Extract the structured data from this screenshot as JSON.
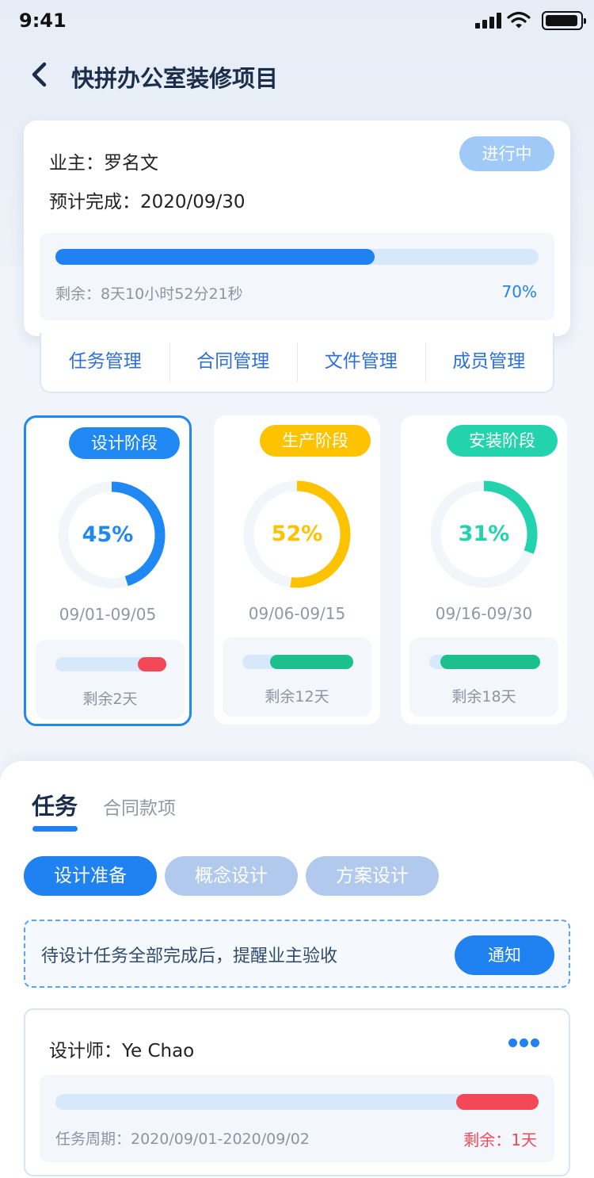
{
  "status_bar": {
    "time": "9:41"
  },
  "nav": {
    "title": "快拼办公室装修项目"
  },
  "project": {
    "owner": "业主：罗名文",
    "expected_finish": "预计完成：2020/09/30",
    "status": "进行中",
    "progress": 0.66,
    "remaining": "剩余：8天10小时52分21秒",
    "percent_label": "70%"
  },
  "management_tabs": [
    "任务管理",
    "合同管理",
    "文件管理",
    "成员管理"
  ],
  "stages": [
    {
      "name": "设计阶段",
      "percent_label": "45%",
      "progress": 0.45,
      "dates": "09/01-09/05",
      "remaining": "剩余2天",
      "color": "#1f88f2",
      "bar_color": "#f34858",
      "bar_start": 0.74,
      "bar_end": 1.0,
      "active": true
    },
    {
      "name": "生产阶段",
      "percent_label": "52%",
      "progress": 0.52,
      "dates": "09/06-09/15",
      "remaining": "剩余12天",
      "color": "#fdc200",
      "bar_color": "#1cc08c",
      "bar_start": 0.25,
      "bar_end": 1.0,
      "active": false
    },
    {
      "name": "安装阶段",
      "percent_label": "31%",
      "progress": 0.31,
      "dates": "09/16-09/30",
      "remaining": "剩余18天",
      "color": "#22d3ae",
      "bar_color": "#1cc08c",
      "bar_start": 0.1,
      "bar_end": 1.0,
      "active": false
    }
  ],
  "bottom": {
    "tab_active": "任务",
    "tab_inactive": "合同款项",
    "chips": [
      {
        "label": "设计准备",
        "active": true
      },
      {
        "label": "概念设计",
        "active": false
      },
      {
        "label": "方案设计",
        "active": false
      }
    ],
    "notice": "待设计任务全部完成后，提醒业主验收",
    "notice_button": "通知",
    "designer": "设计师：Ye Chao",
    "task_cycle": "任务周期：2020/09/01-2020/09/02",
    "task_remaining": "剩余：1天",
    "task_bar_start": 0.83,
    "task_bar_end": 1.0
  },
  "colors": {
    "primary": "#1f82f0",
    "design": "#1f88f2",
    "production": "#fdc200",
    "install": "#22d3ae",
    "danger": "#f34858",
    "chip_inactive": "#b1c9ec"
  },
  "icons": {
    "back": "chevron-left-icon",
    "more": "more-dots-icon",
    "signal": "signal-icon",
    "wifi": "wifi-icon",
    "battery": "battery-icon"
  }
}
